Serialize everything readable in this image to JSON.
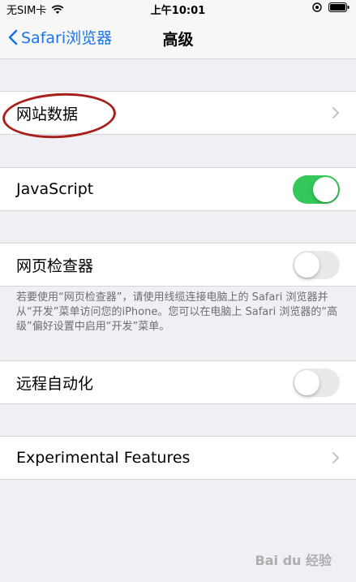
{
  "status_bar": {
    "carrier": "无SIM卡",
    "time": "上午10:01"
  },
  "nav": {
    "back_label": "Safari浏览器",
    "title": "高级"
  },
  "rows": {
    "website_data": {
      "label": "网站数据"
    },
    "javascript": {
      "label": "JavaScript",
      "state": "on"
    },
    "web_inspector": {
      "label": "网页检查器",
      "state": "off"
    },
    "remote_automation": {
      "label": "远程自动化",
      "state": "off"
    },
    "experimental": {
      "label": "Experimental Features"
    }
  },
  "inspector_footnote": "若要使用“网页检查器”，请使用线缆连接电脑上的 Safari 浏览器并从“开发”菜单访问您的iPhone。您可以在电脑上 Safari 浏览器的“高级”偏好设置中启用“开发”菜单。",
  "watermark": "Bai du 经验",
  "colors": {
    "accent": "#1a73e8",
    "toggle_on": "#34c759",
    "annotation": "#a8201a"
  },
  "icons": [
    "wifi-icon",
    "location-icon",
    "battery-icon",
    "chevron-left-icon",
    "chevron-right-icon"
  ]
}
